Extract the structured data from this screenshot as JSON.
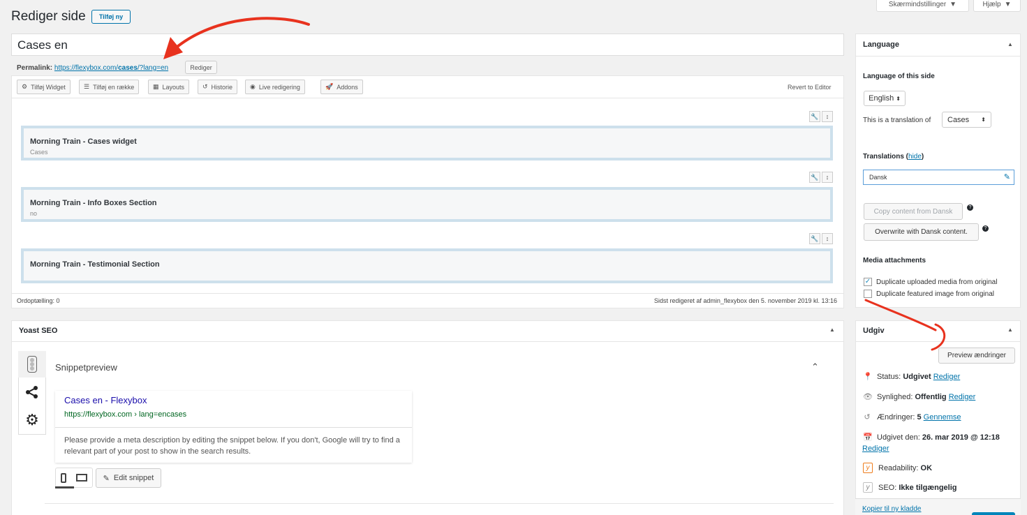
{
  "header": {
    "title": "Rediger side",
    "add_new": "Tilføj ny",
    "screen_options": "Skærmindstillinger",
    "help": "Hjælp"
  },
  "editor": {
    "post_title": "Cases en",
    "permalink_label": "Permalink:",
    "permalink_base": "https://flexybox.com/",
    "permalink_slug": "cases",
    "permalink_suffix": "/?lang=en",
    "edit_permalink": "Rediger",
    "toolbar": [
      {
        "label": "Tilføj Widget",
        "icon": "widget-icon"
      },
      {
        "label": "Tilføj en række",
        "icon": "row-icon"
      },
      {
        "label": "Layouts",
        "icon": "layouts-icon"
      },
      {
        "label": "Historie",
        "icon": "history-icon"
      },
      {
        "label": "Live redigering",
        "icon": "eye-icon"
      },
      {
        "label": "Addons",
        "icon": "rocket-icon"
      }
    ],
    "revert": "Revert to Editor",
    "widgets": [
      {
        "title": "Morning Train - Cases widget",
        "subtitle": "Cases"
      },
      {
        "title": "Morning Train - Info Boxes Section",
        "subtitle": "no"
      },
      {
        "title": "Morning Train - Testimonial Section",
        "subtitle": ""
      }
    ],
    "word_count": "Ordoptælling: 0",
    "last_edited": "Sidst redigeret af admin_flexybox den 5. november 2019 kl. 13:16"
  },
  "yoast": {
    "title": "Yoast SEO",
    "snippet_heading": "Snippetpreview",
    "snippet_title": "Cases en - Flexybox",
    "snippet_url": "https://flexybox.com › lang=encases",
    "snippet_desc": "Please provide a meta description by editing the snippet below. If you don't, Google will try to find a relevant part of your post to show in the search results.",
    "edit_snippet": "Edit snippet"
  },
  "language": {
    "title": "Language",
    "lang_of_side": "Language of this side",
    "current_lang": "English",
    "translation_of_label": "This is a translation of",
    "translation_of_value": "Cases",
    "translations_label": "Translations",
    "hide_link": "hide",
    "translation_entry": "Dansk",
    "copy_content": "Copy content from Dansk",
    "overwrite": "Overwrite with Dansk content.",
    "media_heading": "Media attachments",
    "media_opt1": "Duplicate uploaded media from original",
    "media_opt1_checked": true,
    "media_opt2": "Duplicate featured image from original",
    "media_opt2_checked": false
  },
  "publish": {
    "title": "Udgiv",
    "preview": "Preview ændringer",
    "status_label": "Status:",
    "status_value": "Udgivet",
    "visibility_label": "Synlighed:",
    "visibility_value": "Offentlig",
    "revisions_label": "Ændringer:",
    "revisions_value": "5",
    "revisions_link": "Gennemse",
    "published_label": "Udgivet den:",
    "published_value": "26. mar 2019 @ 12:18",
    "edit_link": "Rediger",
    "readability_label": "Readability:",
    "readability_value": "OK",
    "seo_label": "SEO:",
    "seo_value": "Ikke tilgængelig",
    "copy_draft": "Kopier til ny kladde"
  },
  "colors": {
    "accent": "#0073aa",
    "annotation_arrow": "#e8321e",
    "snippet_title": "#1a0dab",
    "snippet_url": "#006621"
  }
}
